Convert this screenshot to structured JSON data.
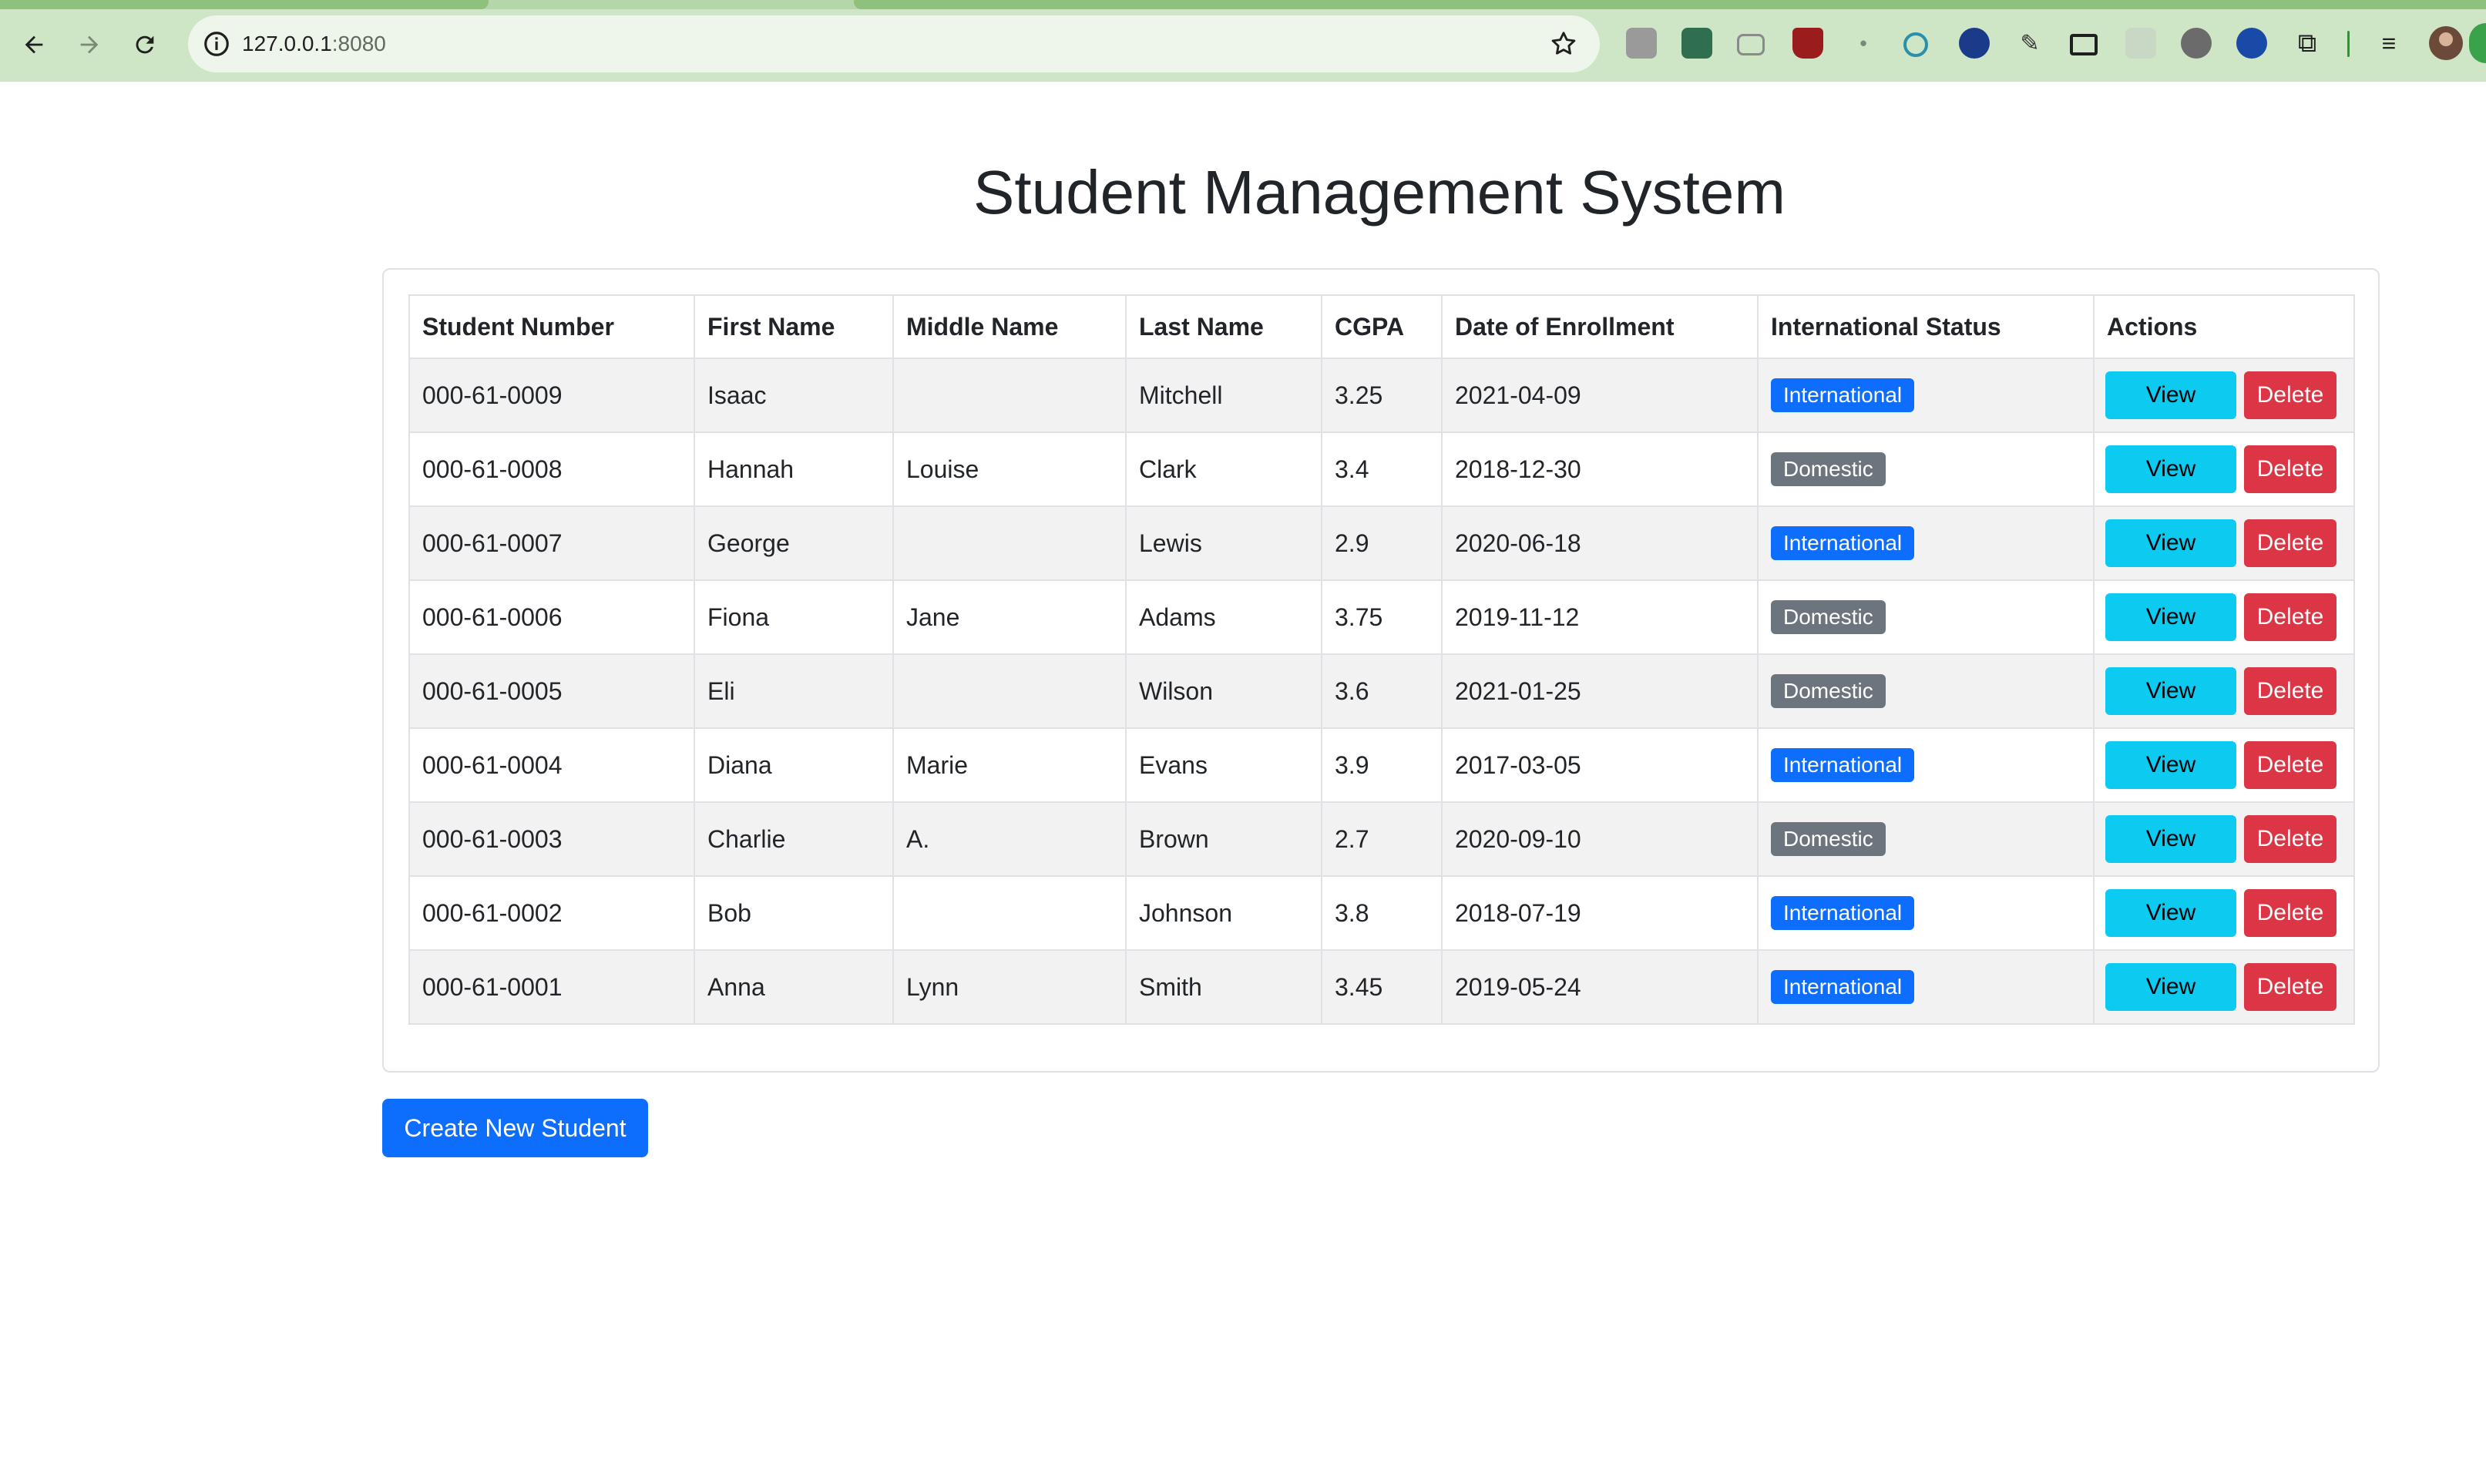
{
  "browser": {
    "url_host": "127.0.0.1",
    "url_port": ":8080"
  },
  "page": {
    "title": "Student Management System",
    "create_button": "Create New Student"
  },
  "table": {
    "headers": [
      "Student Number",
      "First Name",
      "Middle Name",
      "Last Name",
      "CGPA",
      "Date of Enrollment",
      "International Status",
      "Actions"
    ],
    "view_label": "View",
    "delete_label": "Delete",
    "rows": [
      {
        "number": "000-61-0009",
        "first": "Isaac",
        "middle": "",
        "last": "Mitchell",
        "cgpa": "3.25",
        "date": "2021-04-09",
        "status": "International"
      },
      {
        "number": "000-61-0008",
        "first": "Hannah",
        "middle": "Louise",
        "last": "Clark",
        "cgpa": "3.4",
        "date": "2018-12-30",
        "status": "Domestic"
      },
      {
        "number": "000-61-0007",
        "first": "George",
        "middle": "",
        "last": "Lewis",
        "cgpa": "2.9",
        "date": "2020-06-18",
        "status": "International"
      },
      {
        "number": "000-61-0006",
        "first": "Fiona",
        "middle": "Jane",
        "last": "Adams",
        "cgpa": "3.75",
        "date": "2019-11-12",
        "status": "Domestic"
      },
      {
        "number": "000-61-0005",
        "first": "Eli",
        "middle": "",
        "last": "Wilson",
        "cgpa": "3.6",
        "date": "2021-01-25",
        "status": "Domestic"
      },
      {
        "number": "000-61-0004",
        "first": "Diana",
        "middle": "Marie",
        "last": "Evans",
        "cgpa": "3.9",
        "date": "2017-03-05",
        "status": "International"
      },
      {
        "number": "000-61-0003",
        "first": "Charlie",
        "middle": "A.",
        "last": "Brown",
        "cgpa": "2.7",
        "date": "2020-09-10",
        "status": "Domestic"
      },
      {
        "number": "000-61-0002",
        "first": "Bob",
        "middle": "",
        "last": "Johnson",
        "cgpa": "3.8",
        "date": "2018-07-19",
        "status": "International"
      },
      {
        "number": "000-61-0001",
        "first": "Anna",
        "middle": "Lynn",
        "last": "Smith",
        "cgpa": "3.45",
        "date": "2019-05-24",
        "status": "International"
      }
    ]
  },
  "colors": {
    "international_badge": "#0d6efd",
    "domestic_badge": "#6c757d",
    "view_button": "#0dcaf0",
    "delete_button": "#dc3545",
    "primary_button": "#0d6efd",
    "browser_frame": "#cfe6c6"
  },
  "icons": [
    "back-arrow-icon",
    "forward-arrow-icon",
    "reload-icon",
    "site-info-icon",
    "bookmark-star-icon",
    "extension-icons",
    "profile-avatar"
  ]
}
